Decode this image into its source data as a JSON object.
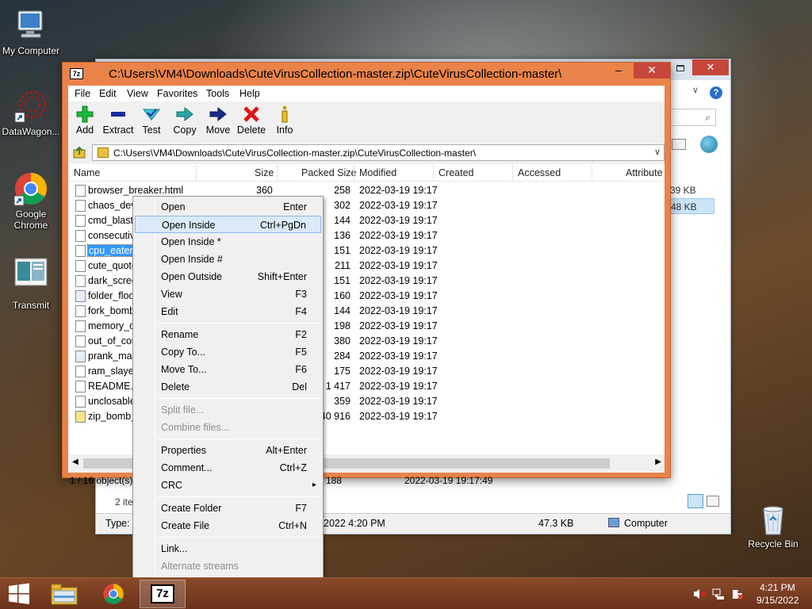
{
  "desktop": {
    "icons": [
      {
        "label": "My Computer",
        "icon": "computer-icon"
      },
      {
        "label": "DataWagon...",
        "icon": "datawagon-icon"
      },
      {
        "label": "Google Chrome",
        "icon": "chrome-icon"
      },
      {
        "label": "Transmit",
        "icon": "transmit-icon"
      },
      {
        "label": "Recycle Bin",
        "icon": "recycle-bin-icon"
      }
    ]
  },
  "background_window": {
    "size_a": "39 KB",
    "size_b": "48 KB",
    "items_count": "2 ite",
    "type_label": "Type: z",
    "date": "2022 4:20 PM",
    "size_total": "47.3 KB",
    "location": "Computer"
  },
  "zip_window": {
    "title": "C:\\Users\\VM4\\Downloads\\CuteVirusCollection-master.zip\\CuteVirusCollection-master\\",
    "title_icon": "7z",
    "menu": [
      "File",
      "Edit",
      "View",
      "Favorites",
      "Tools",
      "Help"
    ],
    "toolbar": [
      {
        "label": "Add",
        "icon": "plus-icon"
      },
      {
        "label": "Extract",
        "icon": "minus-icon"
      },
      {
        "label": "Test",
        "icon": "test-icon"
      },
      {
        "label": "Copy",
        "icon": "copy-arrow-icon"
      },
      {
        "label": "Move",
        "icon": "move-arrow-icon"
      },
      {
        "label": "Delete",
        "icon": "delete-x-icon"
      },
      {
        "label": "Info",
        "icon": "info-icon"
      }
    ],
    "address": "C:\\Users\\VM4\\Downloads\\CuteVirusCollection-master.zip\\CuteVirusCollection-master\\",
    "columns": [
      "Name",
      "Size",
      "Packed Size",
      "Modified",
      "Created",
      "Accessed",
      "Attribute"
    ],
    "files": [
      {
        "name": "browser_breaker.html",
        "size": "360",
        "packed": "258",
        "modified": "2022-03-19 19:17"
      },
      {
        "name": "chaos_devi",
        "size": "",
        "packed": "302",
        "modified": "2022-03-19 19:17"
      },
      {
        "name": "cmd_blast.",
        "size": "",
        "packed": "144",
        "modified": "2022-03-19 19:17"
      },
      {
        "name": "consecutiv",
        "size": "",
        "packed": "136",
        "modified": "2022-03-19 19:17"
      },
      {
        "name": "cpu_eater.b",
        "size": "",
        "packed": "151",
        "modified": "2022-03-19 19:17"
      },
      {
        "name": "cute_quote",
        "size": "",
        "packed": "211",
        "modified": "2022-03-19 19:17"
      },
      {
        "name": "dark_scree",
        "size": "",
        "packed": "151",
        "modified": "2022-03-19 19:17"
      },
      {
        "name": "folder_floo",
        "size": "",
        "packed": "160",
        "modified": "2022-03-19 19:17"
      },
      {
        "name": "fork_bomb",
        "size": "",
        "packed": "144",
        "modified": "2022-03-19 19:17"
      },
      {
        "name": "memory_c",
        "size": "",
        "packed": "198",
        "modified": "2022-03-19 19:17"
      },
      {
        "name": "out_of_cor",
        "size": "",
        "packed": "380",
        "modified": "2022-03-19 19:17"
      },
      {
        "name": "prank_mas",
        "size": "",
        "packed": "284",
        "modified": "2022-03-19 19:17"
      },
      {
        "name": "ram_slayer",
        "size": "",
        "packed": "175",
        "modified": "2022-03-19 19:17"
      },
      {
        "name": "README.m",
        "size": "",
        "packed": "1 417",
        "modified": "2022-03-19 19:17"
      },
      {
        "name": "unclosable",
        "size": "",
        "packed": "359",
        "modified": "2022-03-19 19:17"
      },
      {
        "name": "zip_bomb_",
        "size": "",
        "packed": "40 916",
        "modified": "2022-03-19 19:17"
      }
    ],
    "status": {
      "selection": "1 / 16 object(s)",
      "packed": "188",
      "modified": "2022-03-19 19:17:49"
    }
  },
  "context_menu": {
    "items": [
      {
        "label": "Open",
        "shortcut": "Enter"
      },
      {
        "label": "Open Inside",
        "shortcut": "Ctrl+PgDn"
      },
      {
        "label": "Open Inside *",
        "shortcut": ""
      },
      {
        "label": "Open Inside #",
        "shortcut": ""
      },
      {
        "label": "Open Outside",
        "shortcut": "Shift+Enter"
      },
      {
        "label": "View",
        "shortcut": "F3"
      },
      {
        "label": "Edit",
        "shortcut": "F4"
      },
      {
        "label": "Rename",
        "shortcut": "F2"
      },
      {
        "label": "Copy To...",
        "shortcut": "F5"
      },
      {
        "label": "Move To...",
        "shortcut": "F6"
      },
      {
        "label": "Delete",
        "shortcut": "Del"
      },
      {
        "label": "Split file...",
        "shortcut": ""
      },
      {
        "label": "Combine files...",
        "shortcut": ""
      },
      {
        "label": "Properties",
        "shortcut": "Alt+Enter"
      },
      {
        "label": "Comment...",
        "shortcut": "Ctrl+Z"
      },
      {
        "label": "CRC",
        "shortcut": "▸"
      },
      {
        "label": "Create Folder",
        "shortcut": "F7"
      },
      {
        "label": "Create File",
        "shortcut": "Ctrl+N"
      },
      {
        "label": "Link...",
        "shortcut": ""
      },
      {
        "label": "Alternate streams",
        "shortcut": ""
      }
    ]
  },
  "taskbar": {
    "start_icon": "windows-logo-icon",
    "pinned": [
      "file-explorer-icon",
      "chrome-icon",
      "7zip-icon"
    ],
    "seven_zip_label": "7z",
    "time": "4:21 PM",
    "date": "9/15/2022"
  }
}
